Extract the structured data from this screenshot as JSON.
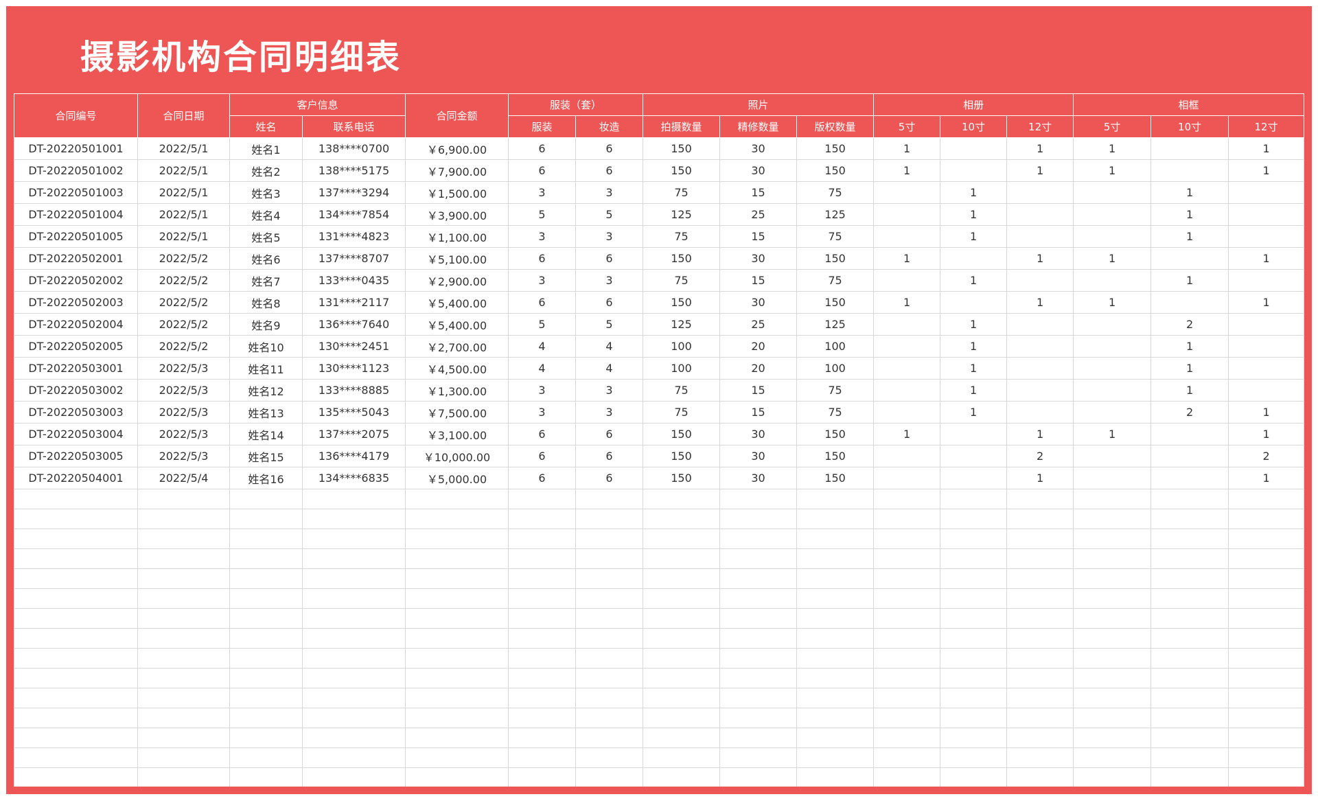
{
  "title": "摄影机构合同明细表",
  "header": {
    "contract_no": "合同编号",
    "contract_date": "合同日期",
    "customer_info": "客户信息",
    "name": "姓名",
    "phone": "联系电话",
    "amount": "合同金额",
    "costume_group": "服装（套）",
    "costume": "服装",
    "makeup": "妆造",
    "photo_group": "照片",
    "shoot_qty": "拍摄数量",
    "retouch_qty": "精修数量",
    "copyright_qty": "版权数量",
    "album_group": "相册",
    "frame_group": "相框",
    "size_5": "5寸",
    "size_10": "10寸",
    "size_12": "12寸"
  },
  "rows": [
    [
      "DT-20220501001",
      "2022/5/1",
      "姓名1",
      "138****0700",
      "￥6,900.00",
      "6",
      "6",
      "150",
      "30",
      "150",
      "1",
      "",
      "1",
      "1",
      "",
      "1"
    ],
    [
      "DT-20220501002",
      "2022/5/1",
      "姓名2",
      "138****5175",
      "￥7,900.00",
      "6",
      "6",
      "150",
      "30",
      "150",
      "1",
      "",
      "1",
      "1",
      "",
      "1"
    ],
    [
      "DT-20220501003",
      "2022/5/1",
      "姓名3",
      "137****3294",
      "￥1,500.00",
      "3",
      "3",
      "75",
      "15",
      "75",
      "",
      "1",
      "",
      "",
      "1",
      ""
    ],
    [
      "DT-20220501004",
      "2022/5/1",
      "姓名4",
      "134****7854",
      "￥3,900.00",
      "5",
      "5",
      "125",
      "25",
      "125",
      "",
      "1",
      "",
      "",
      "1",
      ""
    ],
    [
      "DT-20220501005",
      "2022/5/1",
      "姓名5",
      "131****4823",
      "￥1,100.00",
      "3",
      "3",
      "75",
      "15",
      "75",
      "",
      "1",
      "",
      "",
      "1",
      ""
    ],
    [
      "DT-20220502001",
      "2022/5/2",
      "姓名6",
      "137****8707",
      "￥5,100.00",
      "6",
      "6",
      "150",
      "30",
      "150",
      "1",
      "",
      "1",
      "1",
      "",
      "1"
    ],
    [
      "DT-20220502002",
      "2022/5/2",
      "姓名7",
      "133****0435",
      "￥2,900.00",
      "3",
      "3",
      "75",
      "15",
      "75",
      "",
      "1",
      "",
      "",
      "1",
      ""
    ],
    [
      "DT-20220502003",
      "2022/5/2",
      "姓名8",
      "131****2117",
      "￥5,400.00",
      "6",
      "6",
      "150",
      "30",
      "150",
      "1",
      "",
      "1",
      "1",
      "",
      "1"
    ],
    [
      "DT-20220502004",
      "2022/5/2",
      "姓名9",
      "136****7640",
      "￥5,400.00",
      "5",
      "5",
      "125",
      "25",
      "125",
      "",
      "1",
      "",
      "",
      "2",
      ""
    ],
    [
      "DT-20220502005",
      "2022/5/2",
      "姓名10",
      "130****2451",
      "￥2,700.00",
      "4",
      "4",
      "100",
      "20",
      "100",
      "",
      "1",
      "",
      "",
      "1",
      ""
    ],
    [
      "DT-20220503001",
      "2022/5/3",
      "姓名11",
      "130****1123",
      "￥4,500.00",
      "4",
      "4",
      "100",
      "20",
      "100",
      "",
      "1",
      "",
      "",
      "1",
      ""
    ],
    [
      "DT-20220503002",
      "2022/5/3",
      "姓名12",
      "133****8885",
      "￥1,300.00",
      "3",
      "3",
      "75",
      "15",
      "75",
      "",
      "1",
      "",
      "",
      "1",
      ""
    ],
    [
      "DT-20220503003",
      "2022/5/3",
      "姓名13",
      "135****5043",
      "￥7,500.00",
      "3",
      "3",
      "75",
      "15",
      "75",
      "",
      "1",
      "",
      "",
      "2",
      "1"
    ],
    [
      "DT-20220503004",
      "2022/5/3",
      "姓名14",
      "137****2075",
      "￥3,100.00",
      "6",
      "6",
      "150",
      "30",
      "150",
      "1",
      "",
      "1",
      "1",
      "",
      "1"
    ],
    [
      "DT-20220503005",
      "2022/5/3",
      "姓名15",
      "136****4179",
      "￥10,000.00",
      "6",
      "6",
      "150",
      "30",
      "150",
      "",
      "",
      "2",
      "",
      "",
      "2"
    ],
    [
      "DT-20220504001",
      "2022/5/4",
      "姓名16",
      "134****6835",
      "￥5,000.00",
      "6",
      "6",
      "150",
      "30",
      "150",
      "",
      "",
      "1",
      "",
      "",
      "1"
    ]
  ]
}
